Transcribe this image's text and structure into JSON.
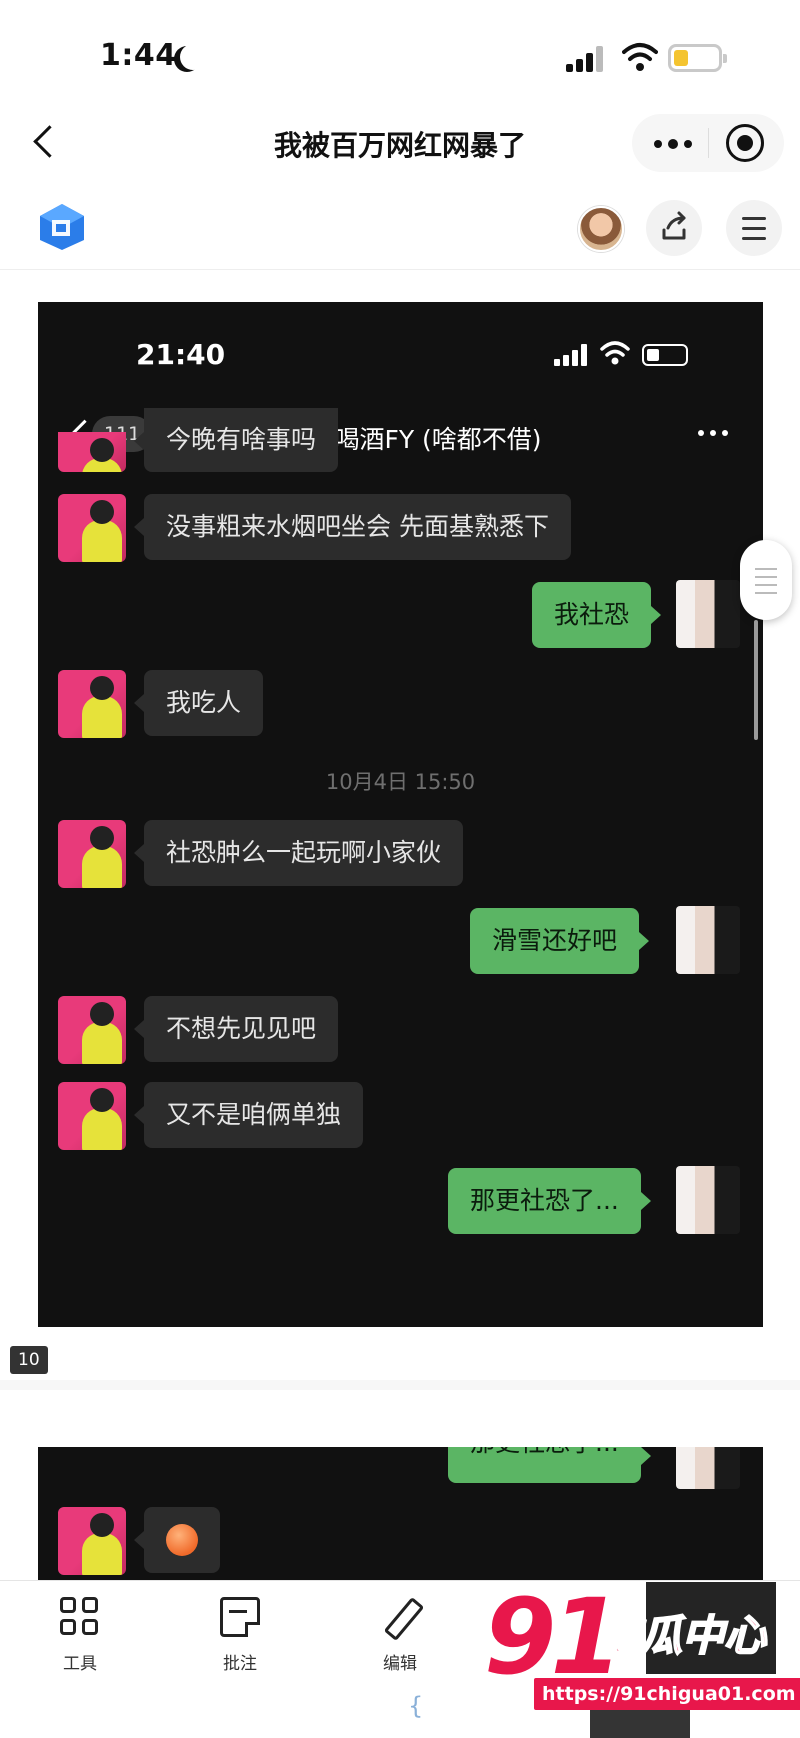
{
  "status_bar": {
    "time": "1:44"
  },
  "title_bar": {
    "title": "我被百万网红网暴了"
  },
  "embedded_chat": {
    "status_time": "21:40",
    "unread_count": "111",
    "chat_title": "老白不喝酒FY (啥都不借)",
    "messages": [
      {
        "side": "in",
        "text": "今晚有啥事吗"
      },
      {
        "side": "in",
        "text": "没事粗来水烟吧坐会 先面基熟悉下"
      },
      {
        "side": "out",
        "text": "我社恐"
      },
      {
        "side": "in",
        "text": "我吃人"
      },
      {
        "side": "time",
        "text": "10月4日 15:50"
      },
      {
        "side": "in",
        "text": "社恐肿么一起玩啊小家伙"
      },
      {
        "side": "out",
        "text": "滑雪还好吧"
      },
      {
        "side": "in",
        "text": "不想先见见吧"
      },
      {
        "side": "in",
        "text": "又不是咱俩单独"
      },
      {
        "side": "out",
        "text": "那更社恐了..."
      }
    ],
    "continued_messages": [
      {
        "side": "out",
        "text": "那更社恐了..."
      },
      {
        "side": "in",
        "emoji": "sweat-smile-emoji"
      }
    ]
  },
  "page_number": "10",
  "bottom_toolbar": {
    "items": [
      {
        "label": "工具",
        "icon": "grid-icon"
      },
      {
        "label": "批注",
        "icon": "note-icon"
      },
      {
        "label": "编辑",
        "icon": "pencil-icon"
      }
    ],
    "bottom_mark": "{"
  },
  "watermark": {
    "brand_number": "91",
    "brand_text": "吃瓜中心",
    "url": "https://91chigua01.com"
  },
  "colors": {
    "incoming_bubble": "#2c2c2c",
    "outgoing_bubble": "#5bb564",
    "watermark": "#e8174b"
  }
}
